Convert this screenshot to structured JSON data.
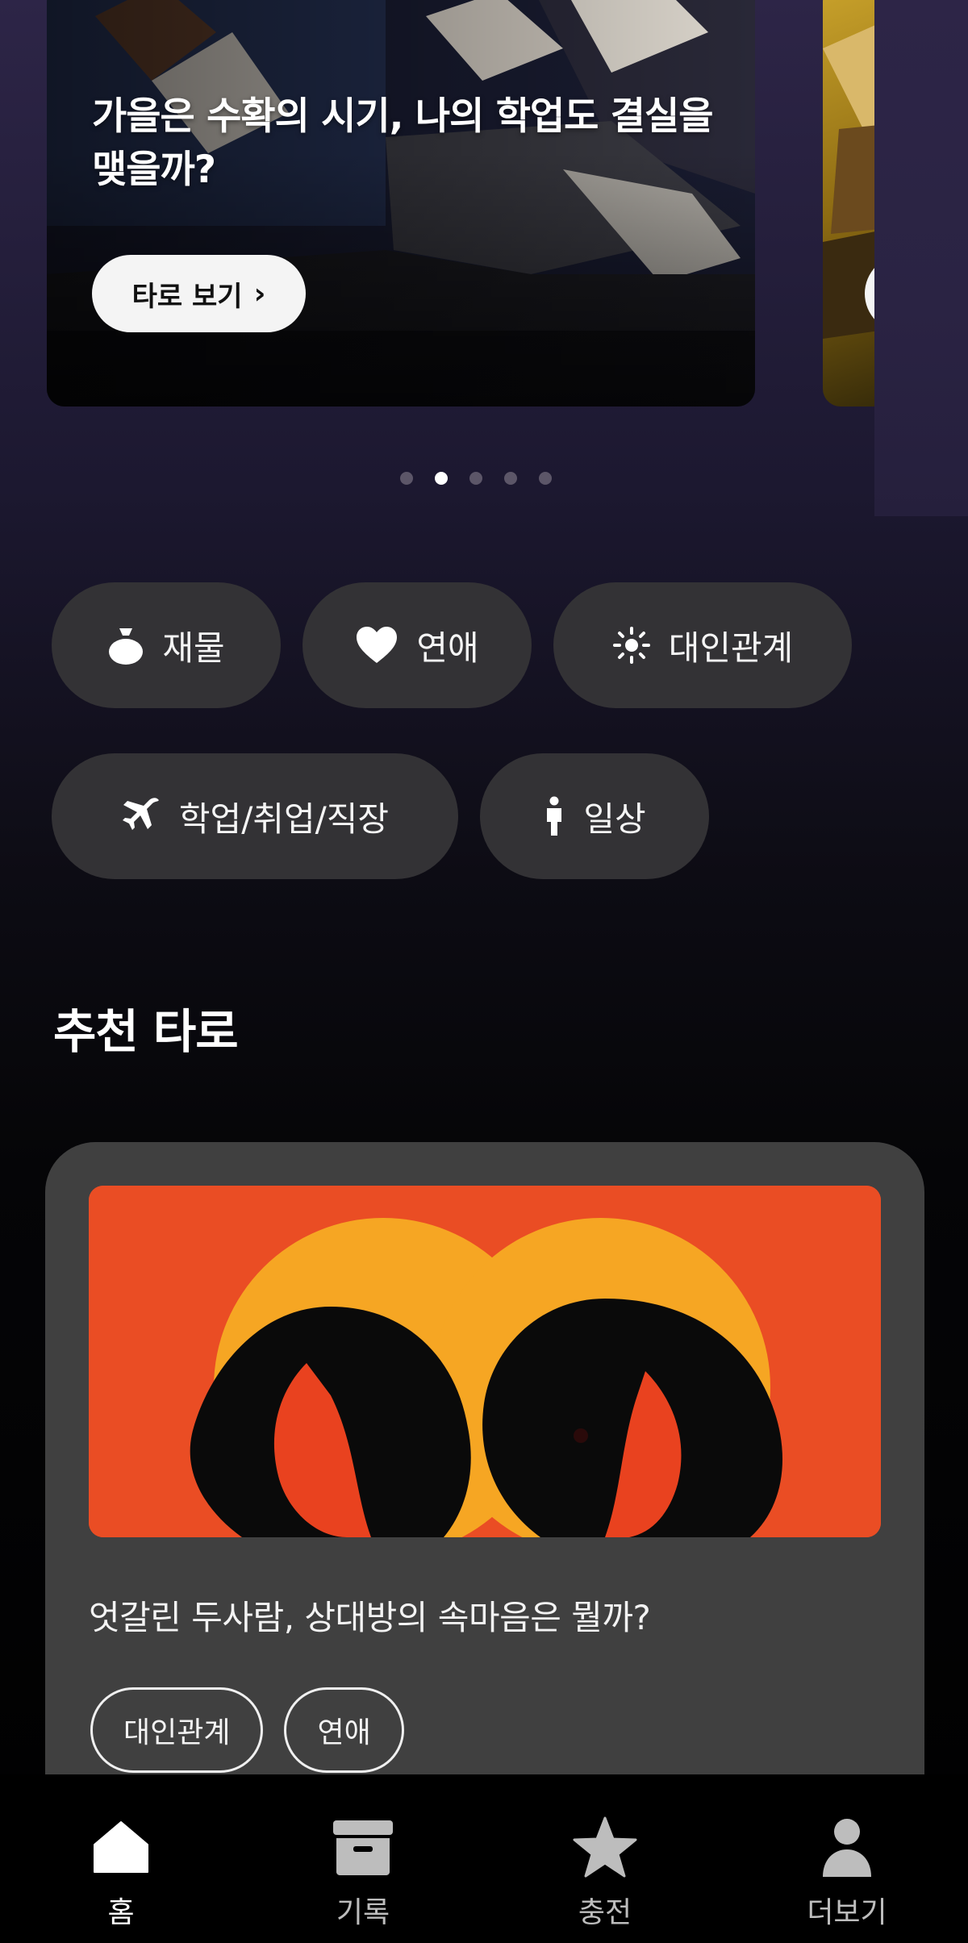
{
  "banner": {
    "title": "가을은 수확의 시기, 나의 학업도 결실을 맺을까?",
    "button_label": "타로 보기",
    "button_chevron": "›"
  },
  "carousel": {
    "page_count": 5,
    "active_index": 1
  },
  "categories": [
    {
      "label": "재물",
      "icon": "money-bag-icon"
    },
    {
      "label": "연애",
      "icon": "heart-icon"
    },
    {
      "label": "대인관계",
      "icon": "sun-icon"
    },
    {
      "label": "학업/취업/직장",
      "icon": "airplane-icon"
    },
    {
      "label": "일상",
      "icon": "person-icon"
    }
  ],
  "recommended": {
    "section_title": "추천 타로",
    "card": {
      "title": "엇갈린 두사람, 상대방의 속마음은 뭘까?",
      "tags": [
        "대인관계",
        "연애"
      ],
      "image_colors": {
        "background": "#ea4d24",
        "halo": "#f6a623",
        "silhouette": "#0a0a0a"
      }
    }
  },
  "bottom_nav": {
    "active": "홈",
    "items": [
      {
        "label": "홈",
        "icon": "home-icon"
      },
      {
        "label": "기록",
        "icon": "archive-box-icon"
      },
      {
        "label": "충전",
        "icon": "star-icon"
      },
      {
        "label": "더보기",
        "icon": "user-icon"
      }
    ]
  },
  "colors": {
    "chip_bg": "#333235",
    "card_bg": "#404040",
    "accent_white": "#ffffff"
  }
}
